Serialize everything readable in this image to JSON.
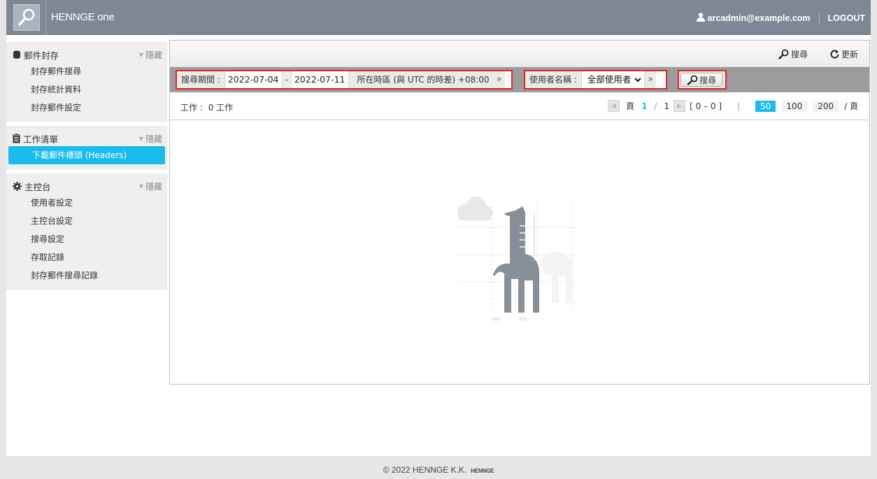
{
  "header": {
    "brand": "HENNGE one",
    "user": "arcadmin@example.com",
    "logout": "LOGOUT"
  },
  "sidebar": {
    "sections": [
      {
        "title": "郵件封存",
        "hide": "隱藏",
        "items": [
          "封存郵件搜尋",
          "封存統計資料",
          "封存郵件設定"
        ]
      },
      {
        "title": "工作清單",
        "hide": "隱藏",
        "items": [
          "下載郵件標頭 (Headers)"
        ]
      },
      {
        "title": "主控台",
        "hide": "隱藏",
        "items": [
          "使用者設定",
          "主控台設定",
          "搜尋設定",
          "存取記錄",
          "封存郵件搜尋記錄"
        ]
      }
    ],
    "active_item": "下載郵件標頭 (Headers)"
  },
  "toolbar": {
    "search_label": "搜尋",
    "refresh_label": "更新"
  },
  "filters": {
    "period_label": "搜尋期間 :",
    "date_from": "2022-07-04",
    "date_sep": "-",
    "date_to": "2022-07-11",
    "timezone": "所在時區 (與 UTC 的時差) +08:00",
    "more": "»",
    "user_label": "使用者名稱 :",
    "user_value": "全部使用者",
    "search_button": "搜尋"
  },
  "status": {
    "jobs_label": "工作 :",
    "jobs_value": "0 工作",
    "page_word": "頁",
    "current_page": "1",
    "page_sep": "/",
    "total_pages": "1",
    "range": "[ 0 – 0 ]",
    "sizes": [
      "50",
      "100",
      "200"
    ],
    "selected_size": "50",
    "per_page_suffix": "/ 頁"
  },
  "footer": {
    "copyright": "© 2022 HENNGE K.K.",
    "mark": "HENNGE"
  },
  "colors": {
    "accent": "#1bbbf0",
    "header_bg": "#7e8894",
    "highlight_border": "#e1251b"
  }
}
